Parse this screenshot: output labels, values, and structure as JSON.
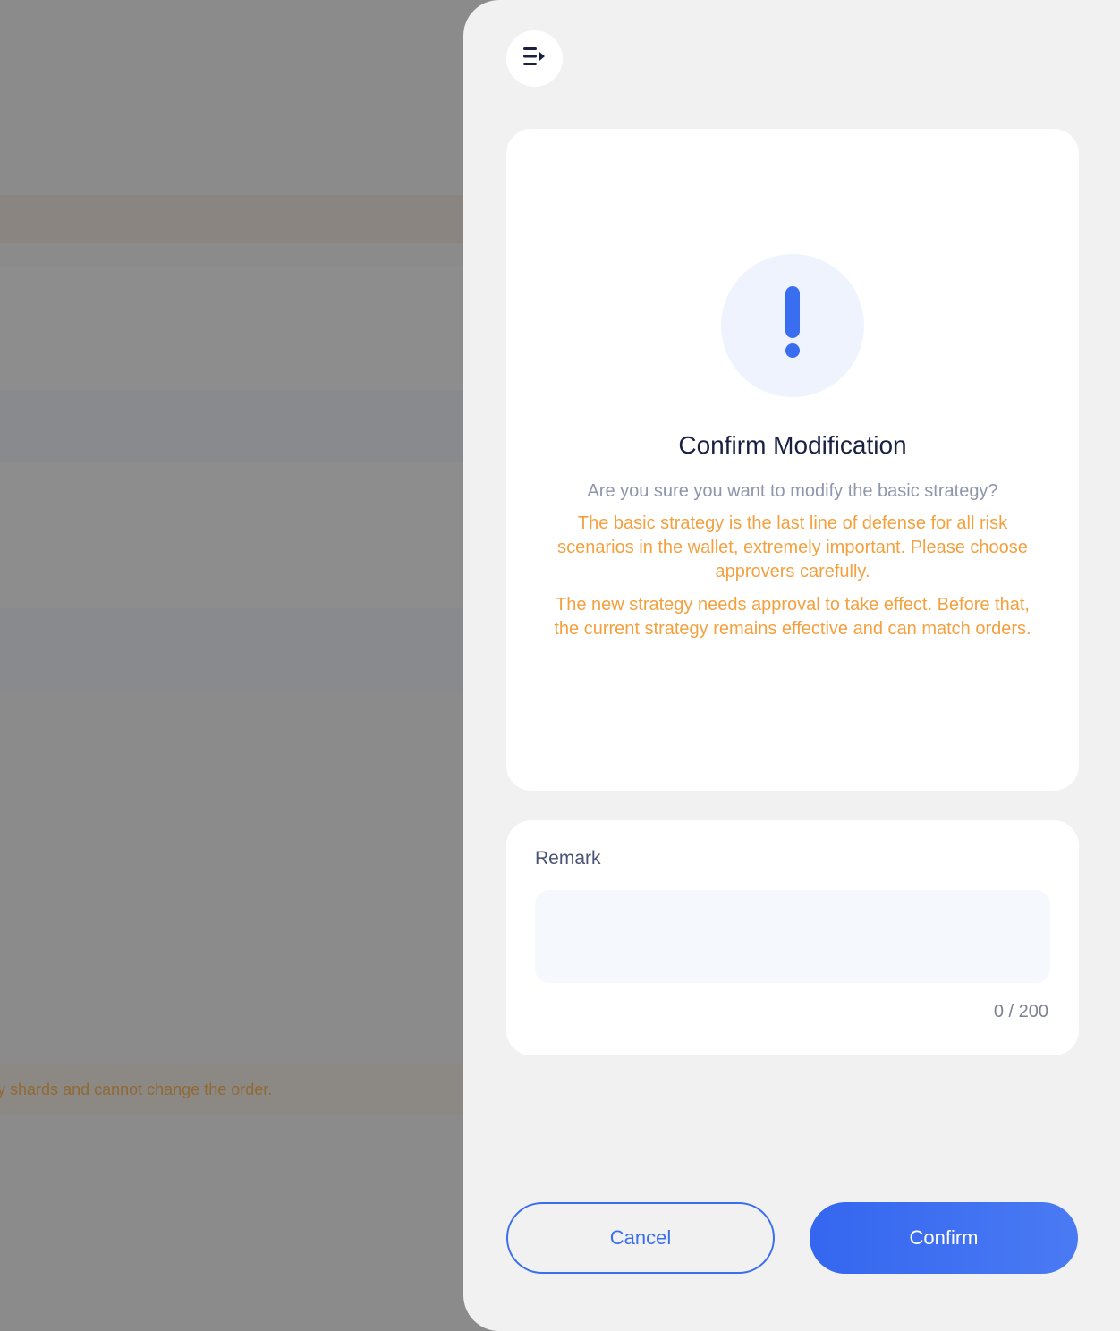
{
  "background": {
    "warning_text": "ate key shards and cannot change the order."
  },
  "drawer": {
    "collapse_icon": "collapse-drawer-icon",
    "dialog": {
      "icon": "exclamation-icon",
      "title": "Confirm Modification",
      "question": "Are you sure you want to modify the basic strategy?",
      "warning_1": "The basic strategy is the last line of defense for all risk scenarios in the wallet, extremely important. Please choose approvers carefully.",
      "warning_2": "The new strategy needs approval to take effect. Before that, the current strategy remains effective and can match orders."
    },
    "remark": {
      "label": "Remark",
      "value": "",
      "placeholder": "",
      "counter": "0 / 200"
    },
    "buttons": {
      "cancel": "Cancel",
      "confirm": "Confirm"
    }
  },
  "colors": {
    "accent": "#3A6EF0",
    "warning": "#F3A03F",
    "overlay": "#8B8B8B",
    "panel": "#F1F1F2"
  }
}
